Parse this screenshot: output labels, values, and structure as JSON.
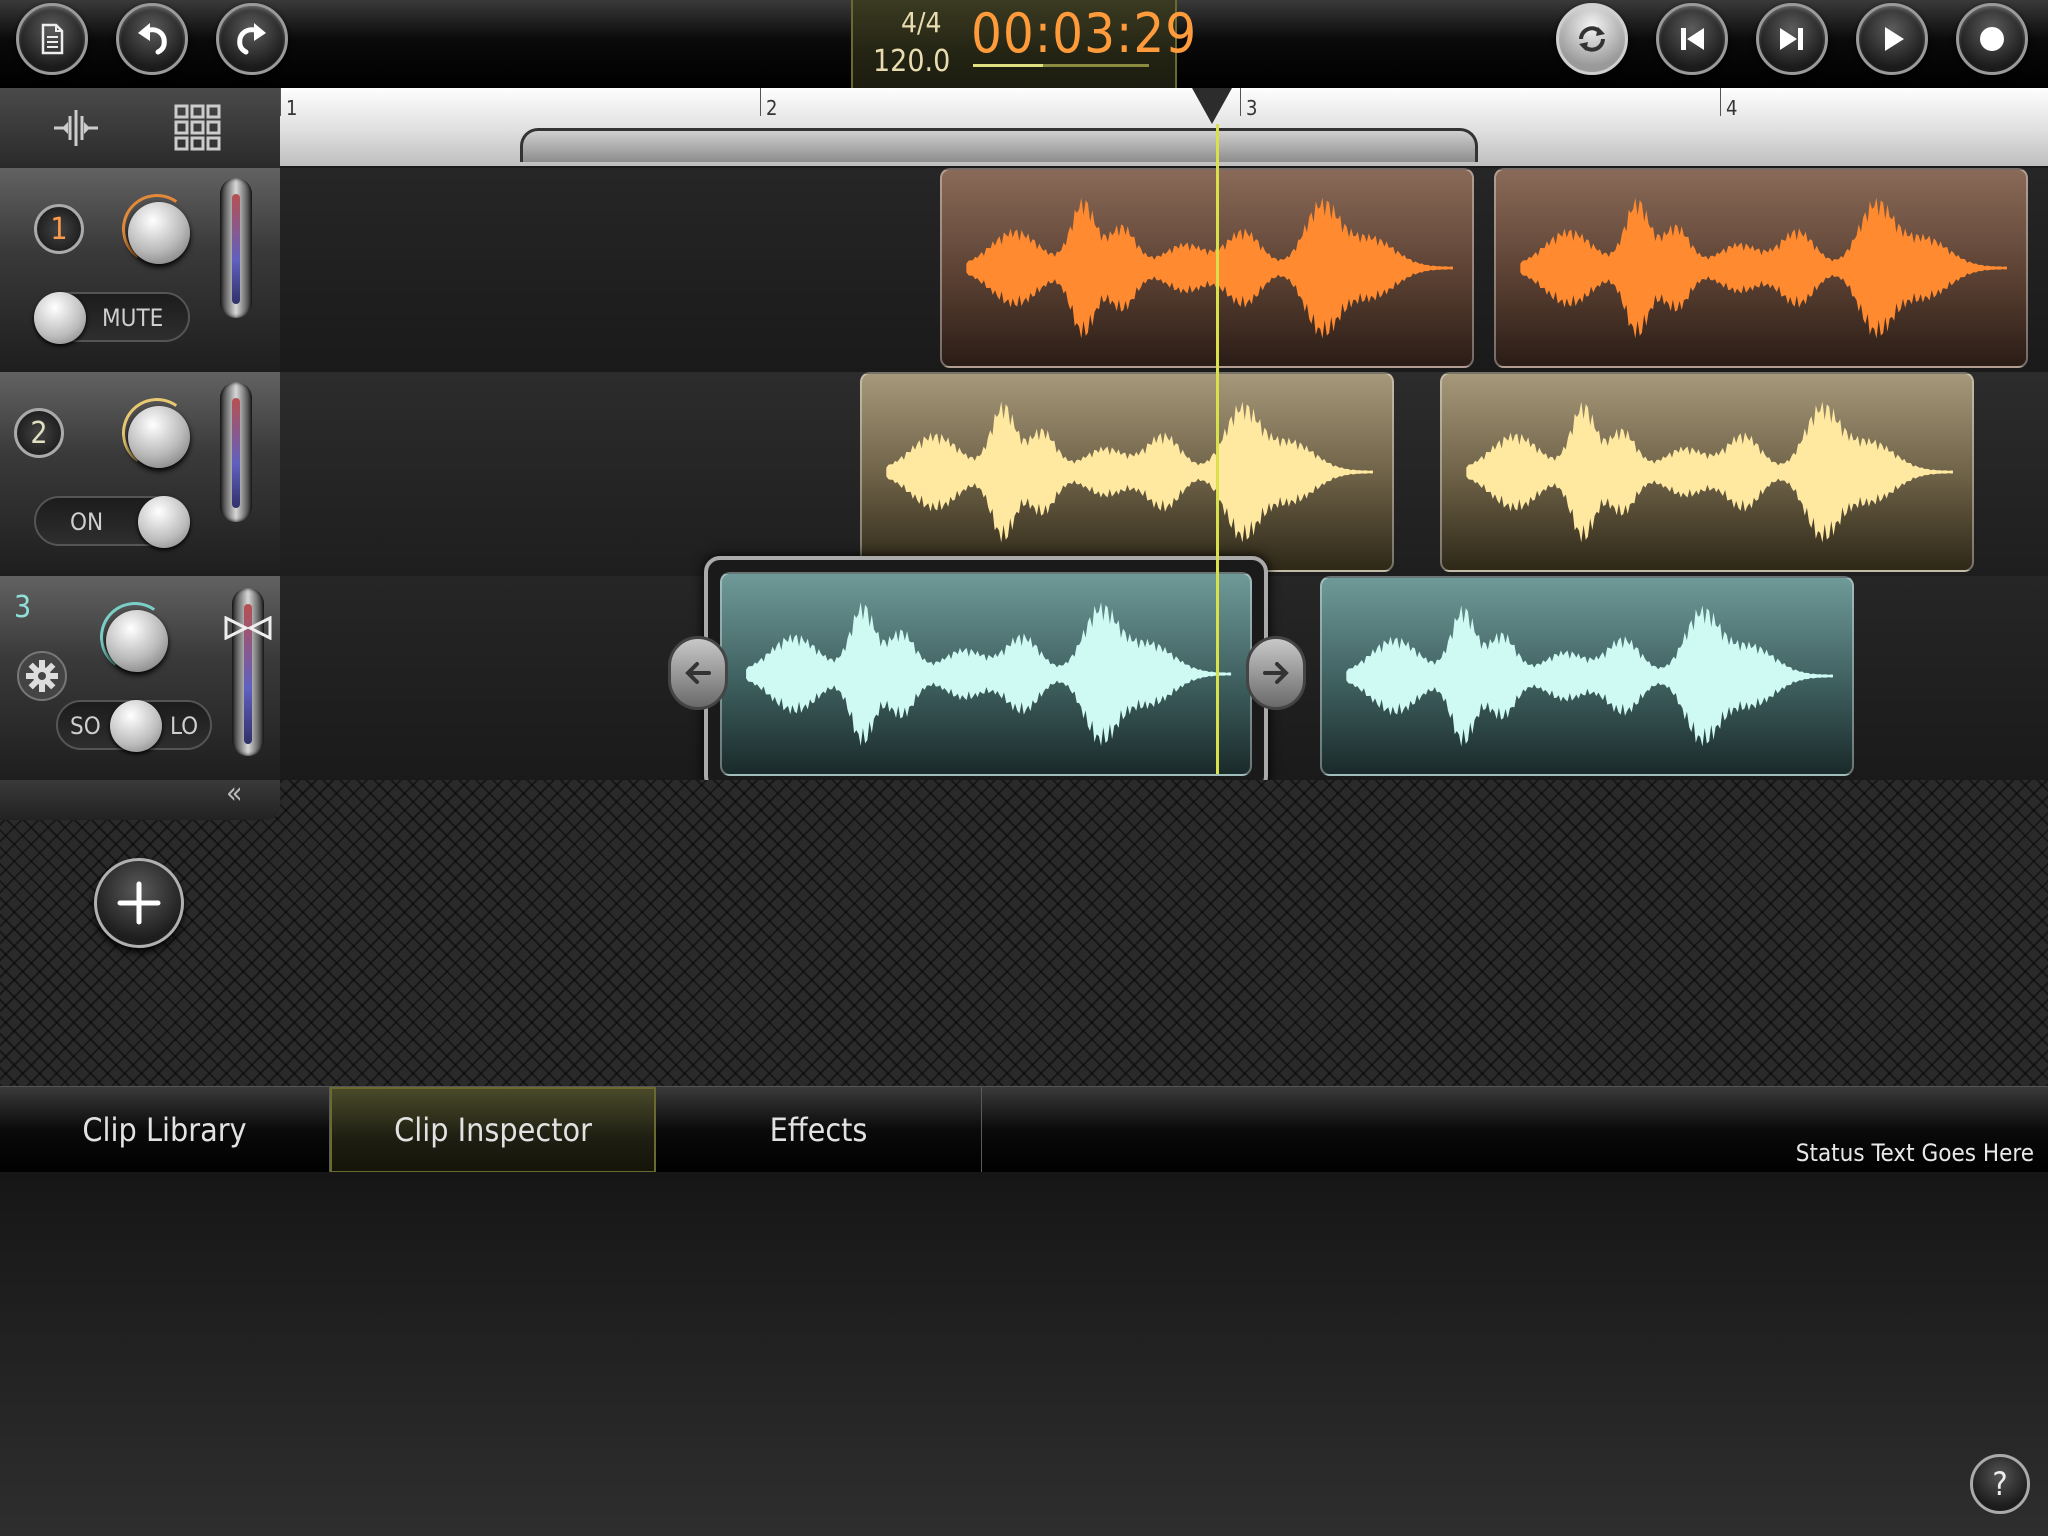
{
  "toolbar": {
    "left_buttons": [
      {
        "icon": "document-icon"
      },
      {
        "icon": "undo-icon"
      },
      {
        "icon": "redo-icon"
      }
    ],
    "right_buttons": [
      {
        "icon": "loop-icon"
      },
      {
        "icon": "skip-back-icon"
      },
      {
        "icon": "skip-forward-icon"
      },
      {
        "icon": "play-icon"
      },
      {
        "icon": "record-icon"
      }
    ]
  },
  "transport": {
    "time_signature": "4/4",
    "tempo": "120.0",
    "clock": "00:03:29",
    "clock_progress": 0.4
  },
  "ruler": {
    "bars": [
      "1",
      "2",
      "3",
      "4"
    ]
  },
  "tools": {
    "left_icon": "split-icon",
    "right_icon": "grid-icon"
  },
  "tracks": [
    {
      "number": "1",
      "toggle_label": "MUTE",
      "color": "#ff8a30",
      "knob_arc_color": "#e38a3a"
    },
    {
      "number": "2",
      "toggle_label": "ON",
      "color": "#ffe9a0",
      "knob_arc_color": "#e8c870"
    },
    {
      "number": "3",
      "toggle_left": "SO",
      "toggle_right": "LO",
      "color": "#cffaf4",
      "knob_arc_color": "#7ad0c8"
    }
  ],
  "collapse_label": "«",
  "tabs": [
    {
      "label": "Clip Library",
      "active": false
    },
    {
      "label": "Clip Inspector",
      "active": true
    },
    {
      "label": "Effects",
      "active": false
    }
  ],
  "status_text": "Status Text Goes Here",
  "help_label": "?"
}
